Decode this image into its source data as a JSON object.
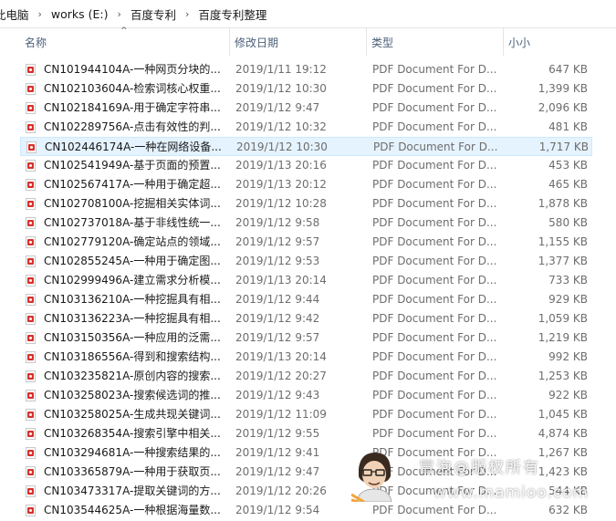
{
  "breadcrumb": [
    "此电脑",
    "works (E:)",
    "百度专利",
    "百度专利整理"
  ],
  "columns": {
    "name": "名称",
    "date": "修改日期",
    "type": "类型",
    "size": "小小"
  },
  "colors": {
    "pdf_icon": "#d9302b",
    "hover_row": "#e5f3ff",
    "header_text": "#4c607a"
  },
  "files": [
    {
      "name": "CN101944104A-一种网页分块的...",
      "date": "2019/1/11 19:12",
      "type": "PDF Document For D...",
      "size": "647 KB"
    },
    {
      "name": "CN102103604A-检索词核心权重...",
      "date": "2019/1/12 10:30",
      "type": "PDF Document For D...",
      "size": "1,399 KB"
    },
    {
      "name": "CN102184169A-用于确定字符串...",
      "date": "2019/1/12 9:47",
      "type": "PDF Document For D...",
      "size": "2,096 KB"
    },
    {
      "name": "CN102289756A-点击有效性的判...",
      "date": "2019/1/12 10:32",
      "type": "PDF Document For D...",
      "size": "481 KB"
    },
    {
      "name": "CN102446174A-一种在网络设备...",
      "date": "2019/1/12 10:30",
      "type": "PDF Document For D...",
      "size": "1,717 KB"
    },
    {
      "name": "CN102541949A-基于页面的预置...",
      "date": "2019/1/13 20:16",
      "type": "PDF Document For D...",
      "size": "453 KB"
    },
    {
      "name": "CN102567417A-一种用于确定超...",
      "date": "2019/1/13 20:12",
      "type": "PDF Document For D...",
      "size": "465 KB"
    },
    {
      "name": "CN102708100A-挖掘相关实体词...",
      "date": "2019/1/12 10:28",
      "type": "PDF Document For D...",
      "size": "1,878 KB"
    },
    {
      "name": "CN102737018A-基于非线性统一...",
      "date": "2019/1/12 9:58",
      "type": "PDF Document For D...",
      "size": "580 KB"
    },
    {
      "name": "CN102779120A-确定站点的领域...",
      "date": "2019/1/12 9:57",
      "type": "PDF Document For D...",
      "size": "1,155 KB"
    },
    {
      "name": "CN102855245A-一种用于确定图...",
      "date": "2019/1/12 9:53",
      "type": "PDF Document For D...",
      "size": "1,377 KB"
    },
    {
      "name": "CN102999496A-建立需求分析模...",
      "date": "2019/1/13 20:14",
      "type": "PDF Document For D...",
      "size": "733 KB"
    },
    {
      "name": "CN103136210A-一种挖掘具有相...",
      "date": "2019/1/12 9:44",
      "type": "PDF Document For D...",
      "size": "929 KB"
    },
    {
      "name": "CN103136223A-一种挖掘具有相...",
      "date": "2019/1/12 9:42",
      "type": "PDF Document For D...",
      "size": "1,059 KB"
    },
    {
      "name": "CN103150356A-一种应用的泛需...",
      "date": "2019/1/12 9:57",
      "type": "PDF Document For D...",
      "size": "1,219 KB"
    },
    {
      "name": "CN103186556A-得到和搜索结构...",
      "date": "2019/1/13 20:14",
      "type": "PDF Document For D...",
      "size": "992 KB"
    },
    {
      "name": "CN103235821A-原创内容的搜索...",
      "date": "2019/1/12 20:27",
      "type": "PDF Document For D...",
      "size": "1,253 KB"
    },
    {
      "name": "CN103258023A-搜索候选词的推...",
      "date": "2019/1/12 9:43",
      "type": "PDF Document For D...",
      "size": "922 KB"
    },
    {
      "name": "CN103258025A-生成共现关键词...",
      "date": "2019/1/12 11:09",
      "type": "PDF Document For D...",
      "size": "1,045 KB"
    },
    {
      "name": "CN103268354A-搜索引擎中相关...",
      "date": "2019/1/12 9:55",
      "type": "PDF Document For D...",
      "size": "4,874 KB"
    },
    {
      "name": "CN103294681A-一种搜索结果的...",
      "date": "2019/1/12 9:41",
      "type": "PDF Document For D...",
      "size": "1,267 KB"
    },
    {
      "name": "CN103365879A-一种用于获取页...",
      "date": "2019/1/12 9:47",
      "type": "PDF Document For D...",
      "size": "1,423 KB"
    },
    {
      "name": "CN103473317A-提取关键词的方...",
      "date": "2019/1/12 20:26",
      "type": "PDF Document For D...",
      "size": "544 KB"
    },
    {
      "name": "CN103544625A-一种根据海量数...",
      "date": "2019/1/12 9:54",
      "type": "PDF Document For D...",
      "size": "632 KB"
    }
  ],
  "watermark": {
    "line1": "冒泡@版权所有",
    "line2": "www.mamioo.com"
  }
}
